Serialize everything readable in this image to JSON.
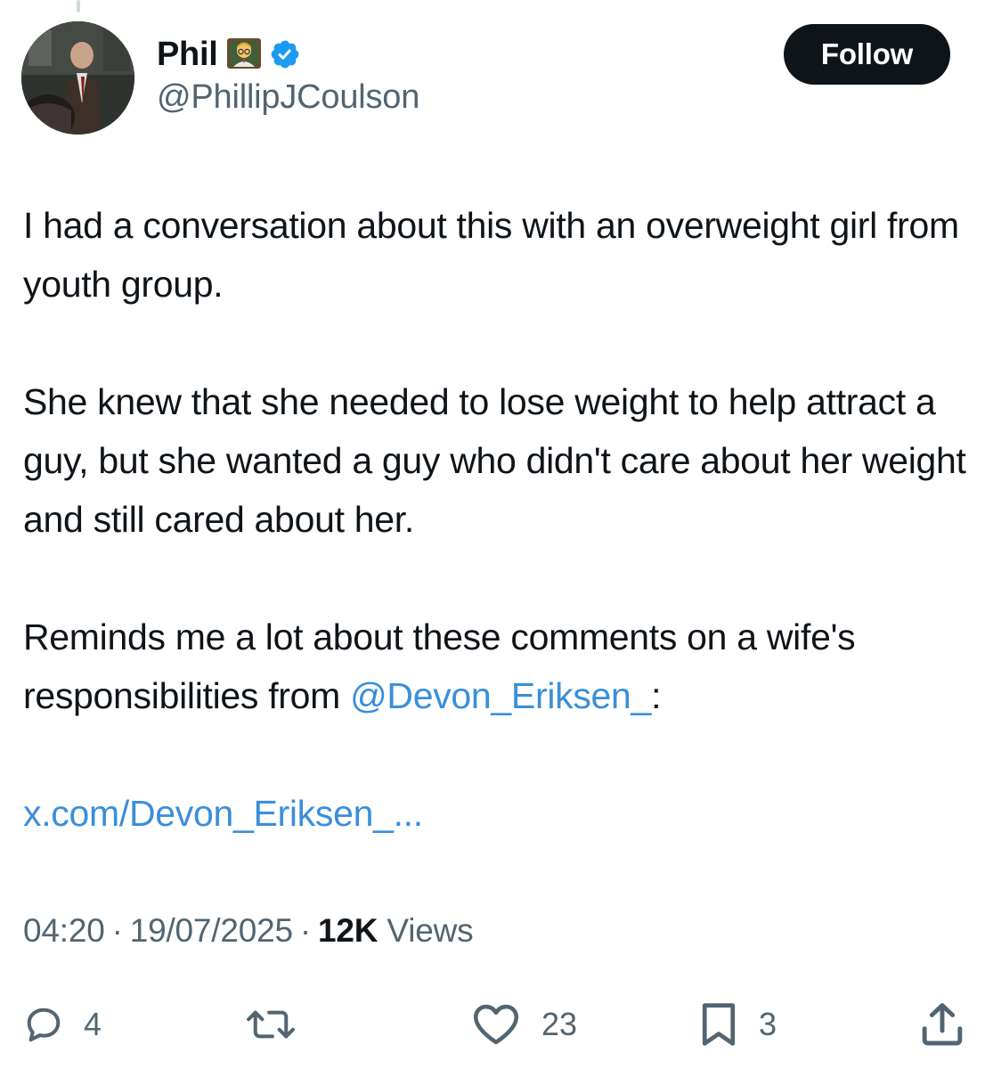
{
  "author": {
    "display_name": "Phil",
    "emoji_icon": "teacher-emoji-icon",
    "verified_icon": "verified-badge-icon",
    "handle": "@PhillipJCoulson",
    "follow_label": "Follow"
  },
  "tweet": {
    "paragraphs": [
      "I had a conversation about this with an overweight girl from youth group.",
      "She knew that she needed to lose weight to help attract a guy, but she wanted a guy who didn't care about her weight and still cared about her."
    ],
    "p3_text": "Reminds me a lot about these comments on a wife's responsibilities from ",
    "p3_mention": "@Devon_Eriksen_",
    "p3_suffix": ":",
    "link": "x.com/Devon_Eriksen_..."
  },
  "meta": {
    "time": "04:20",
    "date": "19/07/2025",
    "views_count": "12K",
    "views_label": "Views"
  },
  "actions": {
    "reply_count": "4",
    "retweet_count": "",
    "like_count": "23",
    "bookmark_count": "3"
  },
  "colors": {
    "link": "#3a8fd9",
    "text": "#0f1419",
    "secondary": "#536471",
    "verified": "#1d9bf0",
    "button_bg": "#0f1419"
  }
}
